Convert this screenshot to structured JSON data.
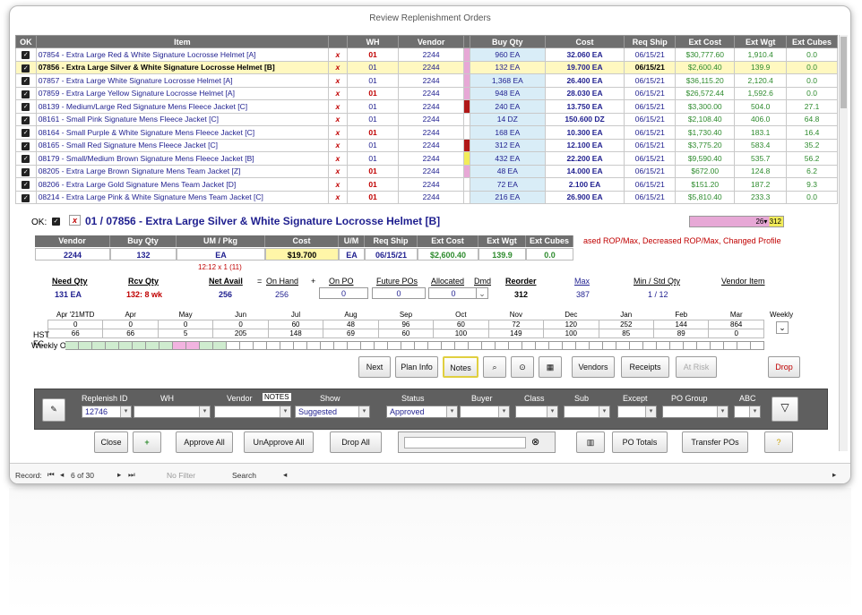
{
  "title": "Review Replenishment Orders",
  "columns": [
    "OK",
    "Item",
    "",
    "WH",
    "Vendor",
    "",
    "Buy Qty",
    "Cost",
    "Req Ship",
    "Ext Cost",
    "Ext Wgt",
    "Ext Cubes"
  ],
  "rows": [
    {
      "item": "07854 - Extra Large Red & White Signature Locrosse Helmet [A]",
      "wh": "01",
      "vendor": "2244",
      "buy": "960 EA",
      "cost": "32.060 EA",
      "ship": "06/15/21",
      "extcost": "$30,777.60",
      "wgt": "1,910.4",
      "cubes": "0.0",
      "flag": "#e7a8d6"
    },
    {
      "item": "07856 - Extra Large Silver & White Signature Locrosse Helmet [B]",
      "wh": "01",
      "vendor": "2244",
      "buy": "132 EA",
      "cost": "19.700 EA",
      "ship": "06/15/21",
      "extcost": "$2,600.40",
      "wgt": "139.9",
      "cubes": "0.0",
      "flag": "#e7a8d6",
      "selected": true
    },
    {
      "item": "07857 - Extra Large White Signature Locrosse Helmet [A]",
      "wh": "01",
      "vendor": "2244",
      "buy": "1,368 EA",
      "cost": "26.400 EA",
      "ship": "06/15/21",
      "extcost": "$36,115.20",
      "wgt": "2,120.4",
      "cubes": "0.0",
      "flag": "#e7a8d6"
    },
    {
      "item": "07859 - Extra Large Yellow Signature Locrosse Helmet [A]",
      "wh": "01",
      "vendor": "2244",
      "buy": "948 EA",
      "cost": "28.030 EA",
      "ship": "06/15/21",
      "extcost": "$26,572.44",
      "wgt": "1,592.6",
      "cubes": "0.0",
      "flag": "#e7a8d6"
    },
    {
      "item": "08139 - Medium/Large Red Signature Mens Fleece Jacket [C]",
      "wh": "01",
      "vendor": "2244",
      "buy": "240 EA",
      "cost": "13.750 EA",
      "ship": "06/15/21",
      "extcost": "$3,300.00",
      "wgt": "504.0",
      "cubes": "27.1",
      "flag": "#b01818"
    },
    {
      "item": "08161 - Small Pink Signature Mens Fleece Jacket [C]",
      "wh": "01",
      "vendor": "2244",
      "buy": "14 DZ",
      "cost": "150.600 DZ",
      "ship": "06/15/21",
      "extcost": "$2,108.40",
      "wgt": "406.0",
      "cubes": "64.8",
      "flag": ""
    },
    {
      "item": "08164 - Small Purple & White Signature Mens Fleece Jacket [C]",
      "wh": "01",
      "vendor": "2244",
      "buy": "168 EA",
      "cost": "10.300 EA",
      "ship": "06/15/21",
      "extcost": "$1,730.40",
      "wgt": "183.1",
      "cubes": "16.4",
      "flag": ""
    },
    {
      "item": "08165 - Small Red Signature Mens Fleece Jacket [C]",
      "wh": "01",
      "vendor": "2244",
      "buy": "312 EA",
      "cost": "12.100 EA",
      "ship": "06/15/21",
      "extcost": "$3,775.20",
      "wgt": "583.4",
      "cubes": "35.2",
      "flag": "#b01818"
    },
    {
      "item": "08179 - Small/Medium Brown Signature Mens Fleece Jacket [B]",
      "wh": "01",
      "vendor": "2244",
      "buy": "432 EA",
      "cost": "22.200 EA",
      "ship": "06/15/21",
      "extcost": "$9,590.40",
      "wgt": "535.7",
      "cubes": "56.2",
      "flag": "#f2ec5a"
    },
    {
      "item": "08205 - Extra Large Brown Signature Mens Team Jacket [Z]",
      "wh": "01",
      "vendor": "2244",
      "buy": "48 EA",
      "cost": "14.000 EA",
      "ship": "06/15/21",
      "extcost": "$672.00",
      "wgt": "124.8",
      "cubes": "6.2",
      "flag": "#e7a8d6"
    },
    {
      "item": "08206 - Extra Large Gold Signature Mens Team Jacket [D]",
      "wh": "01",
      "vendor": "2244",
      "buy": "72 EA",
      "cost": "2.100 EA",
      "ship": "06/15/21",
      "extcost": "$151.20",
      "wgt": "187.2",
      "cubes": "9.3",
      "flag": ""
    },
    {
      "item": "08214 - Extra Large Pink & White Signature Mens Team Jacket [C]",
      "wh": "01",
      "vendor": "2244",
      "buy": "216 EA",
      "cost": "26.900 EA",
      "ship": "06/15/21",
      "extcost": "$5,810.40",
      "wgt": "233.3",
      "cubes": "0.0",
      "flag": ""
    }
  ],
  "detail": {
    "ok_label": "OK:",
    "title": "01 / 07856 - Extra Large Silver & White Signature Locrosse Helmet [B]",
    "meter": "26",
    "meter2": "312",
    "hdr": [
      "Vendor",
      "Buy Qty",
      "UM / Pkg",
      "Cost",
      "U/M",
      "Req Ship",
      "Ext Cost",
      "Ext Wgt",
      "Ext Cubes"
    ],
    "vals": [
      "2244",
      "132",
      "EA",
      "$19.700",
      "EA",
      "06/15/21",
      "$2,600.40",
      "139.9",
      "0.0"
    ],
    "pkg": "12:12 x 1 (11)",
    "flags": "ased ROP/Max,  Decreased ROP/Max,  Changed Profile"
  },
  "stats": {
    "labels": [
      "Need Qty",
      "Rcv Qty",
      "Net Avail",
      "=",
      "On Hand",
      "+",
      "On PO",
      "Future POs",
      "Allocated",
      "Dmd",
      "Reorder",
      "Max",
      "Min / Std Qty",
      "Vendor Item"
    ],
    "need": "131 EA",
    "rcv": "132: 8 wk",
    "net": "256",
    "onhand": "256",
    "onpo": "0",
    "future": "0",
    "alloc": "0",
    "reorder": "312",
    "max": "387",
    "minstd": "1 / 12"
  },
  "calendar": {
    "months": [
      "Apr '21MTD",
      "Apr",
      "May",
      "Jun",
      "Jul",
      "Aug",
      "Sep",
      "Oct",
      "Nov",
      "Dec",
      "Jan",
      "Feb",
      "Mar"
    ],
    "hst": [
      "0",
      "0",
      "0",
      "0",
      "60",
      "48",
      "96",
      "60",
      "72",
      "120",
      "252",
      "144",
      "864"
    ],
    "fc": [
      "66",
      "66",
      "5",
      "205",
      "148",
      "69",
      "60",
      "100",
      "149",
      "100",
      "85",
      "89",
      "0"
    ],
    "hst_label": "HST",
    "fc_label": "FC",
    "weekly_oh": "Weekly OH",
    "weekly": "Weekly"
  },
  "buttons": {
    "next": "Next",
    "plan": "Plan Info",
    "notes": "Notes",
    "vendors": "Vendors",
    "receipts": "Receipts",
    "atrisk": "At Risk",
    "drop": "Drop"
  },
  "filters": {
    "labels": [
      "Replenish ID",
      "WH",
      "Vendor",
      "Show",
      "Status",
      "Buyer",
      "Class",
      "Sub",
      "Except",
      "PO Group",
      "ABC"
    ],
    "notes_tag": "NOTES",
    "id": "12746",
    "show": "Suggested",
    "status": "Approved"
  },
  "actions": {
    "close": "Close",
    "approve": "Approve All",
    "unapprove": "UnApprove All",
    "dropall": "Drop All",
    "pototals": "PO Totals",
    "transfer": "Transfer POs"
  },
  "status": {
    "record": "Record:",
    "pos": "6 of 30",
    "nofilter": "No Filter",
    "search": "Search"
  }
}
